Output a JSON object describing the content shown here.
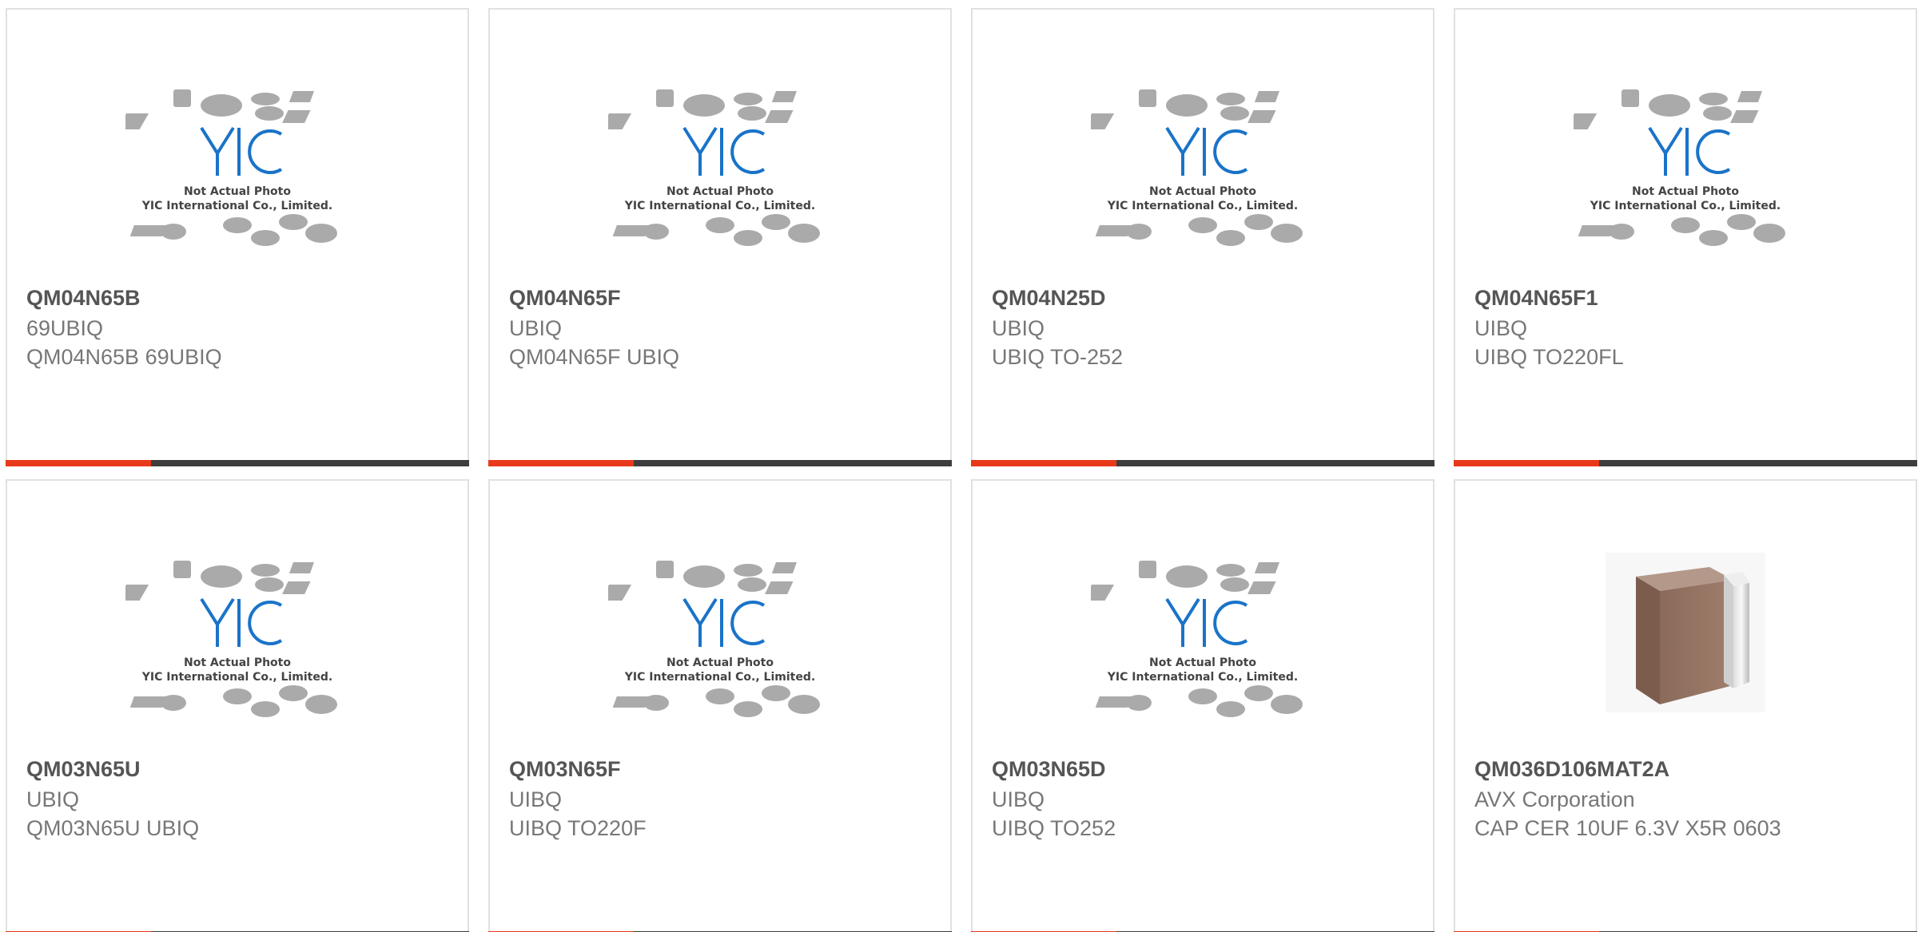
{
  "colors": {
    "accent": "#e8391a",
    "bar": "#3d3d3d",
    "logo_blue": "#1a73c8"
  },
  "placeholder": {
    "line1": "Not Actual Photo",
    "line2": "YIC International Co., Limited."
  },
  "products": [
    {
      "part": "QM04N65B",
      "maker": "69UBIQ",
      "desc": "QM04N65B 69UBIQ",
      "image": "placeholder"
    },
    {
      "part": "QM04N65F",
      "maker": "UBIQ",
      "desc": "QM04N65F UBIQ",
      "image": "placeholder"
    },
    {
      "part": "QM04N25D",
      "maker": "UBIQ",
      "desc": "UBIQ TO-252",
      "image": "placeholder"
    },
    {
      "part": "QM04N65F1",
      "maker": "UIBQ",
      "desc": "UIBQ TO220FL",
      "image": "placeholder"
    },
    {
      "part": "QM03N65U",
      "maker": "UBIQ",
      "desc": "QM03N65U UBIQ",
      "image": "placeholder"
    },
    {
      "part": "QM03N65F",
      "maker": "UIBQ",
      "desc": "UIBQ TO220F",
      "image": "placeholder"
    },
    {
      "part": "QM03N65D",
      "maker": "UIBQ",
      "desc": "UIBQ TO252",
      "image": "placeholder"
    },
    {
      "part": "QM036D106MAT2A",
      "maker": "AVX Corporation",
      "desc": "CAP CER 10UF 6.3V X5R 0603",
      "image": "capacitor"
    }
  ]
}
